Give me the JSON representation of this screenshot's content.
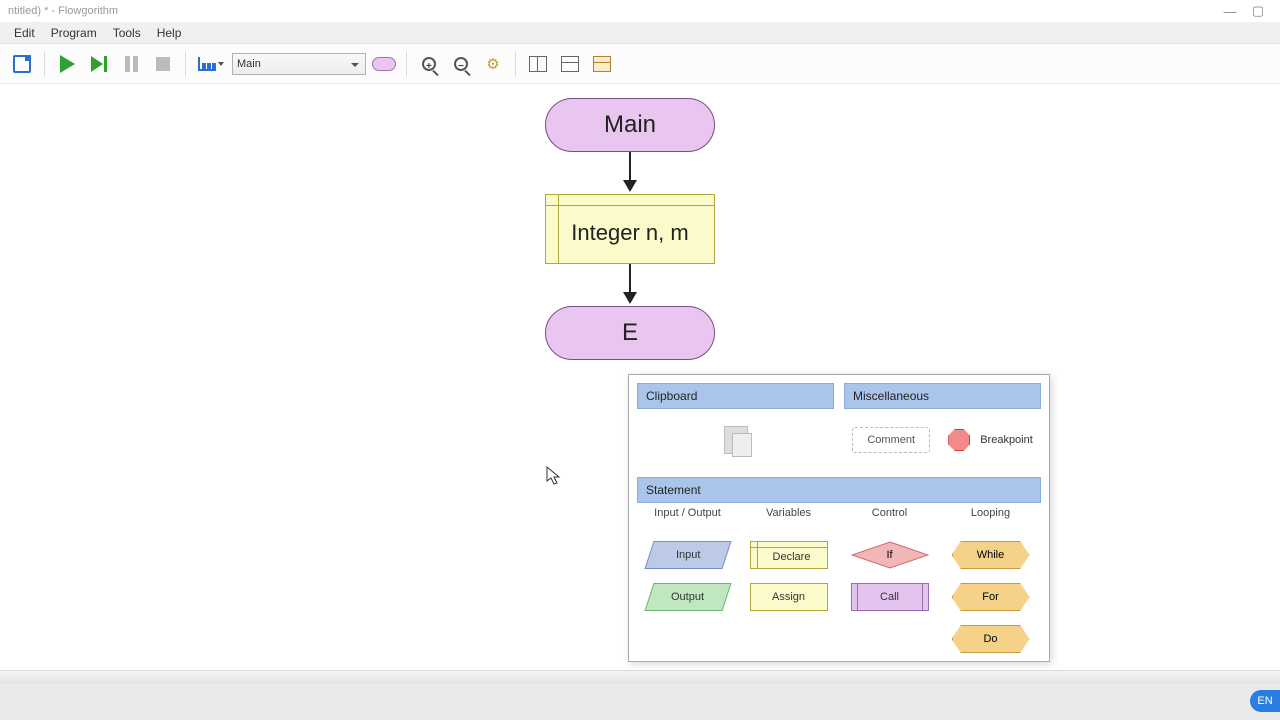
{
  "title": "ntitled) * - Flowgorithm",
  "menu": {
    "edit": "Edit",
    "program": "Program",
    "tools": "Tools",
    "help": "Help"
  },
  "toolbar": {
    "function_selector": "Main"
  },
  "flowchart": {
    "start": "Main",
    "declare": "Integer n, m",
    "end_partial": "E"
  },
  "popup": {
    "clipboard_hdr": "Clipboard",
    "misc_hdr": "Miscellaneous",
    "comment": "Comment",
    "breakpoint": "Breakpoint",
    "statement_hdr": "Statement",
    "cols": {
      "io": "Input / Output",
      "vars": "Variables",
      "ctrl": "Control",
      "loop": "Looping"
    },
    "shapes": {
      "input": "Input",
      "output": "Output",
      "declare": "Declare",
      "assign": "Assign",
      "if": "If",
      "call": "Call",
      "while": "While",
      "for": "For",
      "do": "Do"
    }
  },
  "status": {
    "lang": "EN"
  }
}
